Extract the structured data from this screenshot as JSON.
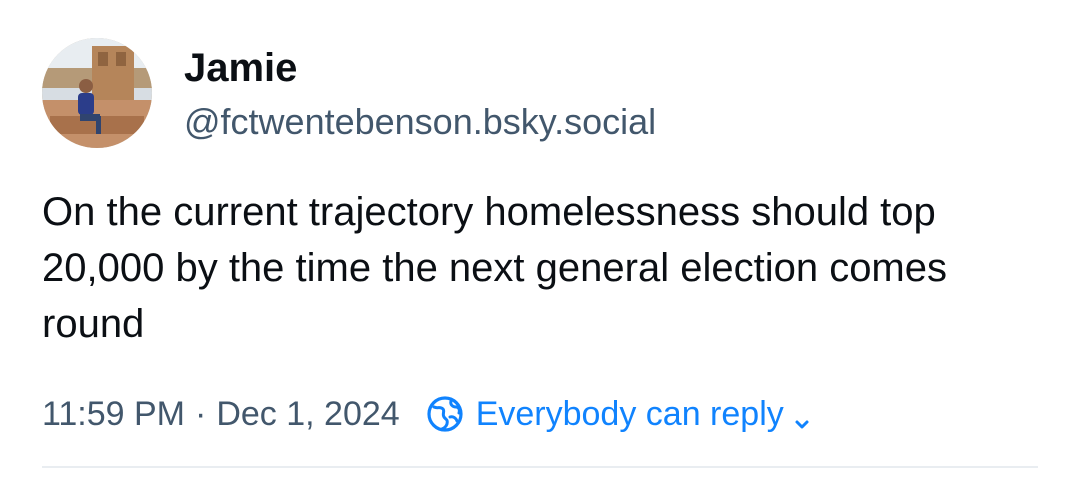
{
  "post": {
    "author": {
      "display_name": "Jamie",
      "handle": "@fctwentebenson.bsky.social"
    },
    "text": "On the current trajectory homelessness should top 20,000 by the time the next general election comes round",
    "time": "11:59 PM",
    "separator": "·",
    "date": "Dec 1, 2024",
    "reply_setting": "Everybody can reply",
    "icons": {
      "reply_setting_icon": "globe-icon",
      "dropdown_icon": "chevron-down-icon"
    },
    "colors": {
      "accent": "#1083fe",
      "text": "#0b0f14",
      "muted": "#42576c"
    }
  }
}
